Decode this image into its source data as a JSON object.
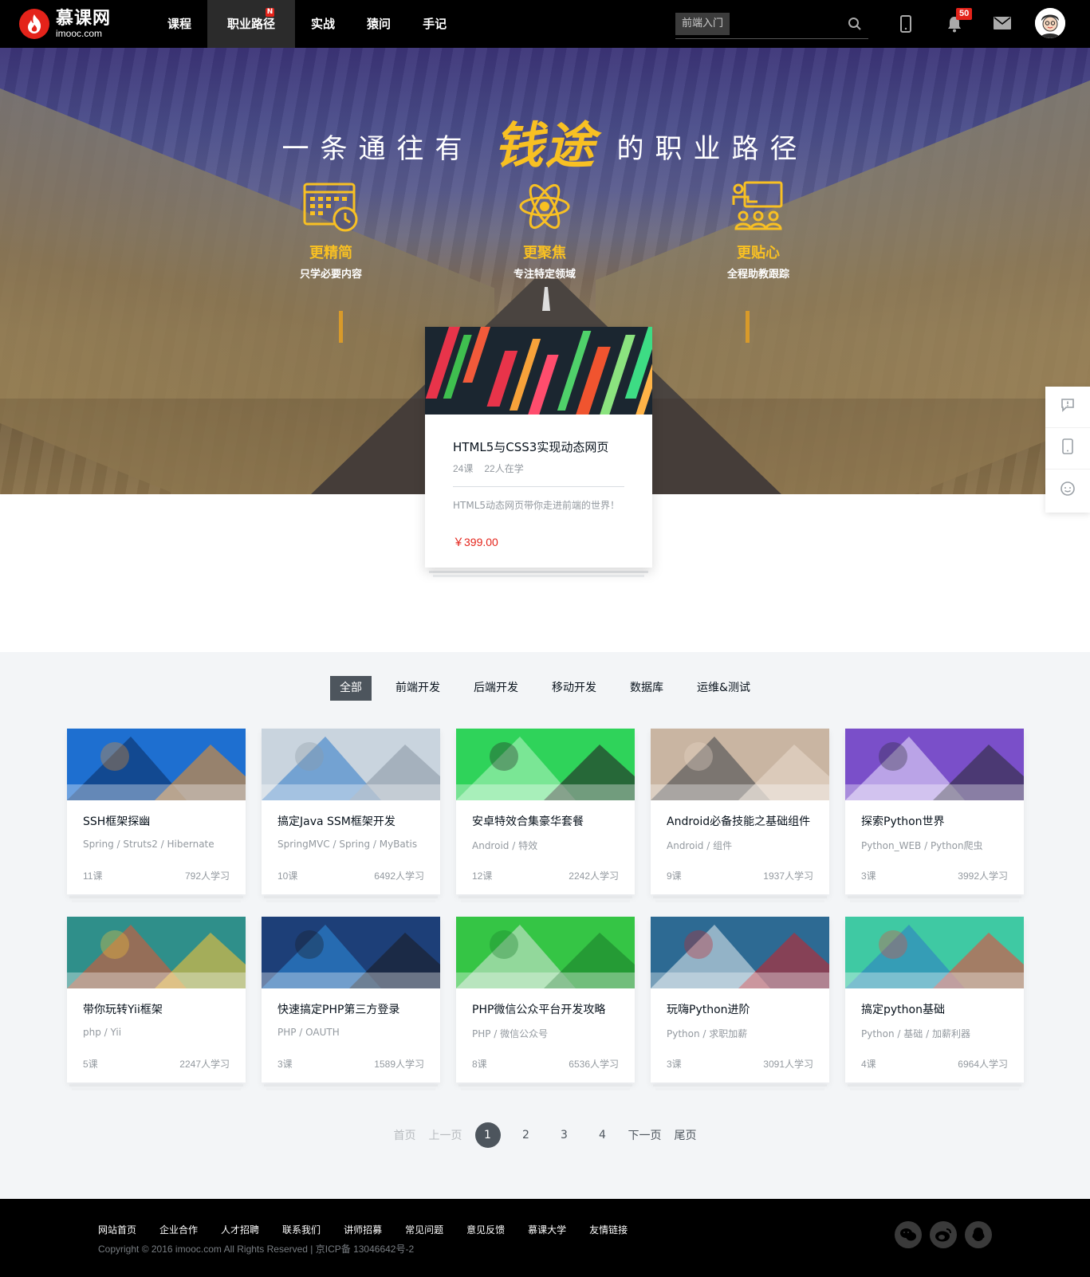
{
  "header": {
    "logo": {
      "name": "慕课网",
      "domain": "imooc.com"
    },
    "nav": [
      {
        "label": "课程"
      },
      {
        "label": "职业路径",
        "badge": "N"
      },
      {
        "label": "实战"
      },
      {
        "label": "猿问"
      },
      {
        "label": "手记"
      }
    ],
    "search": {
      "tag": "前端入门",
      "placeholder": ""
    },
    "notifications_count": "50"
  },
  "hero": {
    "title_pre": "一条通往有",
    "title_highlight": "钱途",
    "title_post": "的职业路径",
    "features": [
      {
        "icon": "calendar-clock-icon",
        "title": "更精简",
        "desc": "只学必要内容"
      },
      {
        "icon": "atom-icon",
        "title": "更聚焦",
        "desc": "专注特定领域"
      },
      {
        "icon": "classroom-icon",
        "title": "更贴心",
        "desc": "全程助教跟踪"
      }
    ],
    "featured_course": {
      "title": "HTML5与CSS3实现动态网页",
      "lessons": "24课",
      "learners": "22人在学",
      "desc": "HTML5动态网页带你走进前端的世界！",
      "price": "￥399.00"
    }
  },
  "tabs": [
    {
      "label": "全部",
      "active": true
    },
    {
      "label": "前端开发"
    },
    {
      "label": "后端开发"
    },
    {
      "label": "移动开发"
    },
    {
      "label": "数据库"
    },
    {
      "label": "运维&测试"
    }
  ],
  "courses": [
    {
      "title": "SSH框架探幽",
      "tags": "Spring / Struts2 / Hibernate",
      "lessons": "11课",
      "learners": "792人学习",
      "theme": [
        "#1e6fd0",
        "#0a2a5c",
        "#e8902c"
      ]
    },
    {
      "title": "搞定Java SSM框架开发",
      "tags": "SpringMVC / Spring / MyBatis",
      "lessons": "10课",
      "learners": "6492人学习",
      "theme": [
        "#c9d4de",
        "#2c78c8",
        "#8d9aa6"
      ]
    },
    {
      "title": "安卓特效合集豪华套餐",
      "tags": "Android / 特效",
      "lessons": "12课",
      "learners": "2242人学习",
      "theme": [
        "#2fd35a",
        "#b8f5c7",
        "#222"
      ]
    },
    {
      "title": "Android必备技能之基础组件",
      "tags": "Android / 组件",
      "lessons": "9课",
      "learners": "1937人学习",
      "theme": [
        "#c9b5a2",
        "#3b3f47",
        "#e7d8c9"
      ]
    },
    {
      "title": "探索Python世界",
      "tags": "Python_WEB / Python爬虫",
      "lessons": "3课",
      "learners": "3992人学习",
      "theme": [
        "#7a4fc9",
        "#efe9ff",
        "#2b2b3a"
      ]
    },
    {
      "title": "带你玩转Yii框架",
      "tags": "php / Yii",
      "lessons": "5课",
      "learners": "2247人学习",
      "theme": [
        "#2f8f8a",
        "#e9532f",
        "#f3c23a"
      ]
    },
    {
      "title": "快速搞定PHP第三方登录",
      "tags": "PHP / OAUTH",
      "lessons": "3课",
      "learners": "1589人学习",
      "theme": [
        "#1d3f78",
        "#2d8fe0",
        "#1a1d24"
      ]
    },
    {
      "title": "PHP微信公众平台开发攻略",
      "tags": "PHP / 微信公众号",
      "lessons": "8课",
      "learners": "6536人学习",
      "theme": [
        "#35c545",
        "#dfe8e1",
        "#1a7f2b"
      ]
    },
    {
      "title": "玩嗨Python进阶",
      "tags": "Python / 求职加薪",
      "lessons": "3课",
      "learners": "3091人学习",
      "theme": [
        "#2d6a93",
        "#e8eef2",
        "#c2272d"
      ]
    },
    {
      "title": "搞定python基础",
      "tags": "Python / 基础 / 加薪利器",
      "lessons": "4课",
      "learners": "6964人学习",
      "theme": [
        "#3fc9a3",
        "#2d79c7",
        "#e64b3c"
      ]
    }
  ],
  "pagination": {
    "first": "首页",
    "prev": "上一页",
    "pages": [
      "1",
      "2",
      "3",
      "4"
    ],
    "current": "1",
    "next": "下一页",
    "last": "尾页"
  },
  "footer": {
    "links": [
      "网站首页",
      "企业合作",
      "人才招聘",
      "联系我们",
      "讲师招募",
      "常见问题",
      "意见反馈",
      "慕课大学",
      "友情链接"
    ],
    "copyright": "Copyright © 2016 imooc.com All Rights Reserved | 京ICP备 13046642号-2",
    "social": [
      "wechat-icon",
      "weibo-icon",
      "qq-icon"
    ]
  },
  "colors": {
    "brand_red": "#e4231a",
    "accent_yellow": "#f8c023",
    "dark": "#07111b",
    "gray_bg": "#f3f5f7"
  }
}
